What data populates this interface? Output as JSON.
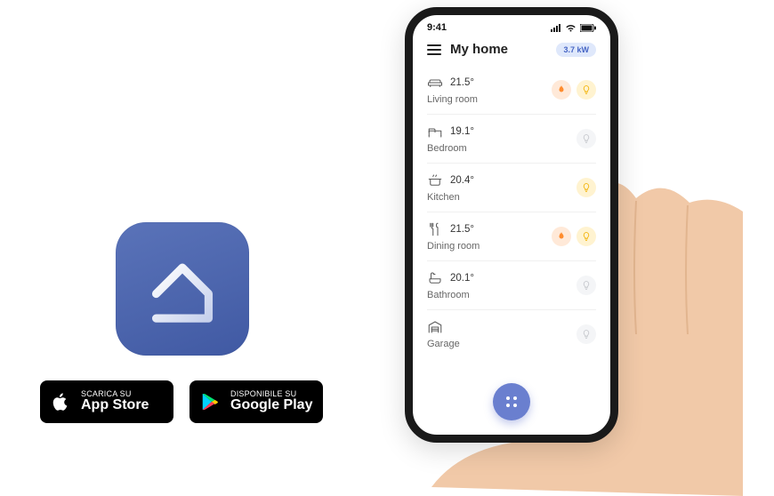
{
  "stores": {
    "apple": {
      "top": "Scarica su",
      "bottom": "App Store"
    },
    "google": {
      "top": "DISPONIBILE SU",
      "bottom": "Google Play"
    }
  },
  "statusbar": {
    "time": "9:41"
  },
  "header": {
    "title": "My home",
    "power": "3.7 kW"
  },
  "rooms": [
    {
      "icon": "sofa",
      "temp": "21.5°",
      "name": "Living room",
      "flame": true,
      "bulb": true
    },
    {
      "icon": "bed",
      "temp": "19.1°",
      "name": "Bedroom",
      "flame": false,
      "bulb": false
    },
    {
      "icon": "pot",
      "temp": "20.4°",
      "name": "Kitchen",
      "flame": false,
      "bulb": true
    },
    {
      "icon": "fork",
      "temp": "21.5°",
      "name": "Dining room",
      "flame": true,
      "bulb": true
    },
    {
      "icon": "bath",
      "temp": "20.1°",
      "name": "Bathroom",
      "flame": false,
      "bulb": false
    },
    {
      "icon": "garage",
      "temp": "",
      "name": "Garage",
      "flame": false,
      "bulb": false
    }
  ]
}
